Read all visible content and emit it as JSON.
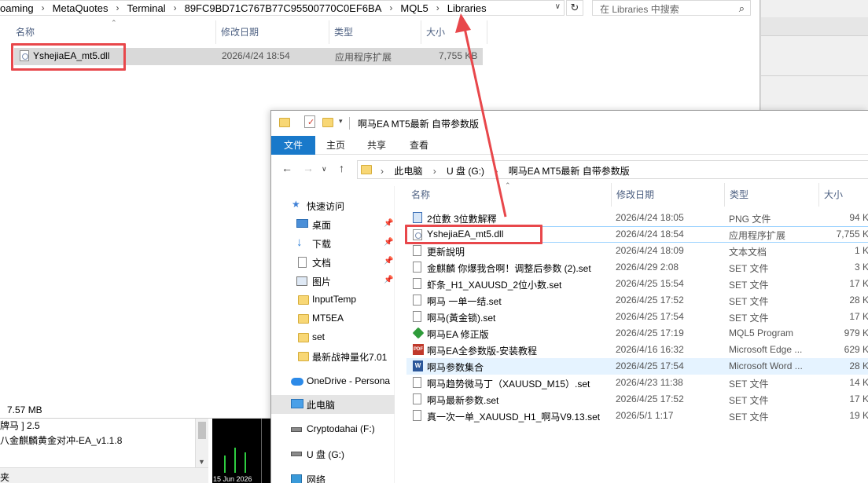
{
  "colors": {
    "annotation_red": "#e8474b",
    "ribbon_file_blue": "#1979ca",
    "selection_blue": "#cce8ff"
  },
  "back_window": {
    "breadcrumb": [
      "oaming",
      "MetaQuotes",
      "Terminal",
      "89FC9BD71C767B77C95500770C0EF6BA",
      "MQL5",
      "Libraries"
    ],
    "search_placeholder": "在 Libraries 中搜索",
    "columns": {
      "name": "名称",
      "date": "修改日期",
      "type": "类型",
      "size": "大小"
    },
    "file": {
      "name": "YshejiaEA_mt5.dll",
      "date": "2026/4/24 18:54",
      "type": "应用程序扩展",
      "size": "7,755 KB"
    },
    "status": "7.57 MB"
  },
  "mt5": {
    "line1": "牌马 ] 2.5",
    "line2": "八金麒麟黄金对冲-EA_v1.1.8",
    "line3": "夹",
    "chart_date": "15 Jun 2026"
  },
  "front_window": {
    "title": "啊马EA MT5最新 自带参数版",
    "ribbon_tabs": [
      "文件",
      "主页",
      "共享",
      "查看"
    ],
    "breadcrumb": [
      "此电脑",
      "U 盘 (G:)",
      "啊马EA MT5最新 自带参数版"
    ],
    "nav": {
      "quick_access": "快速访问",
      "pinned": [
        "桌面",
        "下载",
        "文档",
        "图片"
      ],
      "folders": [
        "InputTemp",
        "MT5EA",
        "set",
        "最新战神量化7.01"
      ],
      "onedrive": "OneDrive - Persona",
      "this_pc": "此电脑",
      "drives": [
        "Cryptodahai (F:)",
        "U 盘 (G:)"
      ],
      "network": "网络"
    },
    "columns": {
      "name": "名称",
      "date": "修改日期",
      "type": "类型",
      "size": "大小"
    },
    "files": [
      {
        "name": "2位數 3位數解釋",
        "date": "2026/4/24 18:05",
        "type": "PNG 文件",
        "size": "94 K",
        "icon": "png-file-icon"
      },
      {
        "name": "YshejiaEA_mt5.dll",
        "date": "2026/4/24 18:54",
        "type": "应用程序扩展",
        "size": "7,755 K",
        "icon": "dll-file-icon"
      },
      {
        "name": "更新說明",
        "date": "2026/4/24 18:09",
        "type": "文本文档",
        "size": "1 K",
        "icon": "text-file-icon"
      },
      {
        "name": "金麒麟 你爆我合啊！调整后参数 (2).set",
        "date": "2026/4/29 2:08",
        "type": "SET 文件",
        "size": "3 K",
        "icon": "set-file-icon"
      },
      {
        "name": "虾条_H1_XAUUSD_2位小数.set",
        "date": "2026/4/25 15:54",
        "type": "SET 文件",
        "size": "17 K",
        "icon": "set-file-icon"
      },
      {
        "name": "啊马 一单一结.set",
        "date": "2026/4/25 17:52",
        "type": "SET 文件",
        "size": "28 K",
        "icon": "set-file-icon"
      },
      {
        "name": "啊马(黃金锁).set",
        "date": "2026/4/25 17:54",
        "type": "SET 文件",
        "size": "17 K",
        "icon": "set-file-icon"
      },
      {
        "name": "啊马EA 修正版",
        "date": "2026/4/25 17:19",
        "type": "MQL5 Program",
        "size": "979 K",
        "icon": "mql5-program-icon"
      },
      {
        "name": "啊马EA全参数版-安装教程",
        "date": "2026/4/16 16:32",
        "type": "Microsoft Edge ...",
        "size": "629 K",
        "icon": "pdf-file-icon"
      },
      {
        "name": "啊马参数集合",
        "date": "2026/4/25 17:54",
        "type": "Microsoft Word ...",
        "size": "28 K",
        "icon": "word-file-icon"
      },
      {
        "name": "啊马趋势微马丁（XAUUSD_M15）.set",
        "date": "2026/4/23 11:38",
        "type": "SET 文件",
        "size": "14 K",
        "icon": "set-file-icon"
      },
      {
        "name": "啊马最新参数.set",
        "date": "2026/4/25 17:52",
        "type": "SET 文件",
        "size": "17 K",
        "icon": "set-file-icon"
      },
      {
        "name": "真一次一单_XAUUSD_H1_啊马V9.13.set",
        "date": "2026/5/1 1:17",
        "type": "SET 文件",
        "size": "19 K",
        "icon": "set-file-icon"
      }
    ]
  }
}
